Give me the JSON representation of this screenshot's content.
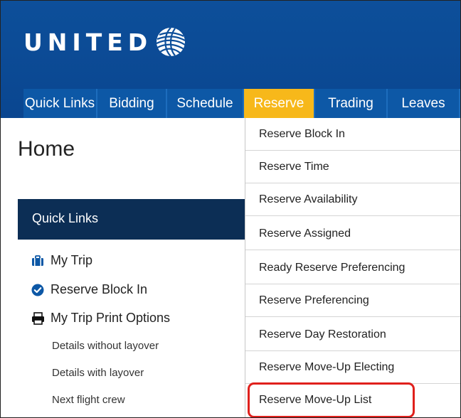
{
  "brand": {
    "name": "UNITED"
  },
  "nav": {
    "tabs": [
      {
        "label": "Quick Links"
      },
      {
        "label": "Bidding"
      },
      {
        "label": "Schedule"
      },
      {
        "label": "Reserve",
        "active": true
      },
      {
        "label": "Trading"
      },
      {
        "label": "Leaves"
      }
    ]
  },
  "page": {
    "title": "Home"
  },
  "quick_links": {
    "title": "Quick Links",
    "items": [
      {
        "label": "My Trip",
        "icon": "briefcase-icon"
      },
      {
        "label": "Reserve Block In",
        "icon": "check-circle-icon"
      },
      {
        "label": "My Trip Print Options",
        "icon": "printer-icon"
      }
    ],
    "sub_items": [
      {
        "label": "Details without layover"
      },
      {
        "label": "Details with layover"
      },
      {
        "label": "Next flight crew"
      }
    ]
  },
  "reserve_menu": {
    "items": [
      {
        "label": "Reserve Block In"
      },
      {
        "label": "Reserve Time"
      },
      {
        "label": "Reserve Availability"
      },
      {
        "label": "Reserve Assigned"
      },
      {
        "label": "Ready Reserve Preferencing"
      },
      {
        "label": "Reserve Preferencing"
      },
      {
        "label": "Reserve Day Restoration"
      },
      {
        "label": "Reserve Move-Up Electing"
      },
      {
        "label": "Reserve Move-Up List"
      }
    ]
  },
  "colors": {
    "header_blue": "#0d4f9a",
    "tab_blue": "#0d58a6",
    "active_tab": "#f7b81a",
    "panel_navy": "#0c2e55",
    "icon_blue": "#0d58a6",
    "highlight_red": "#e0201c"
  }
}
